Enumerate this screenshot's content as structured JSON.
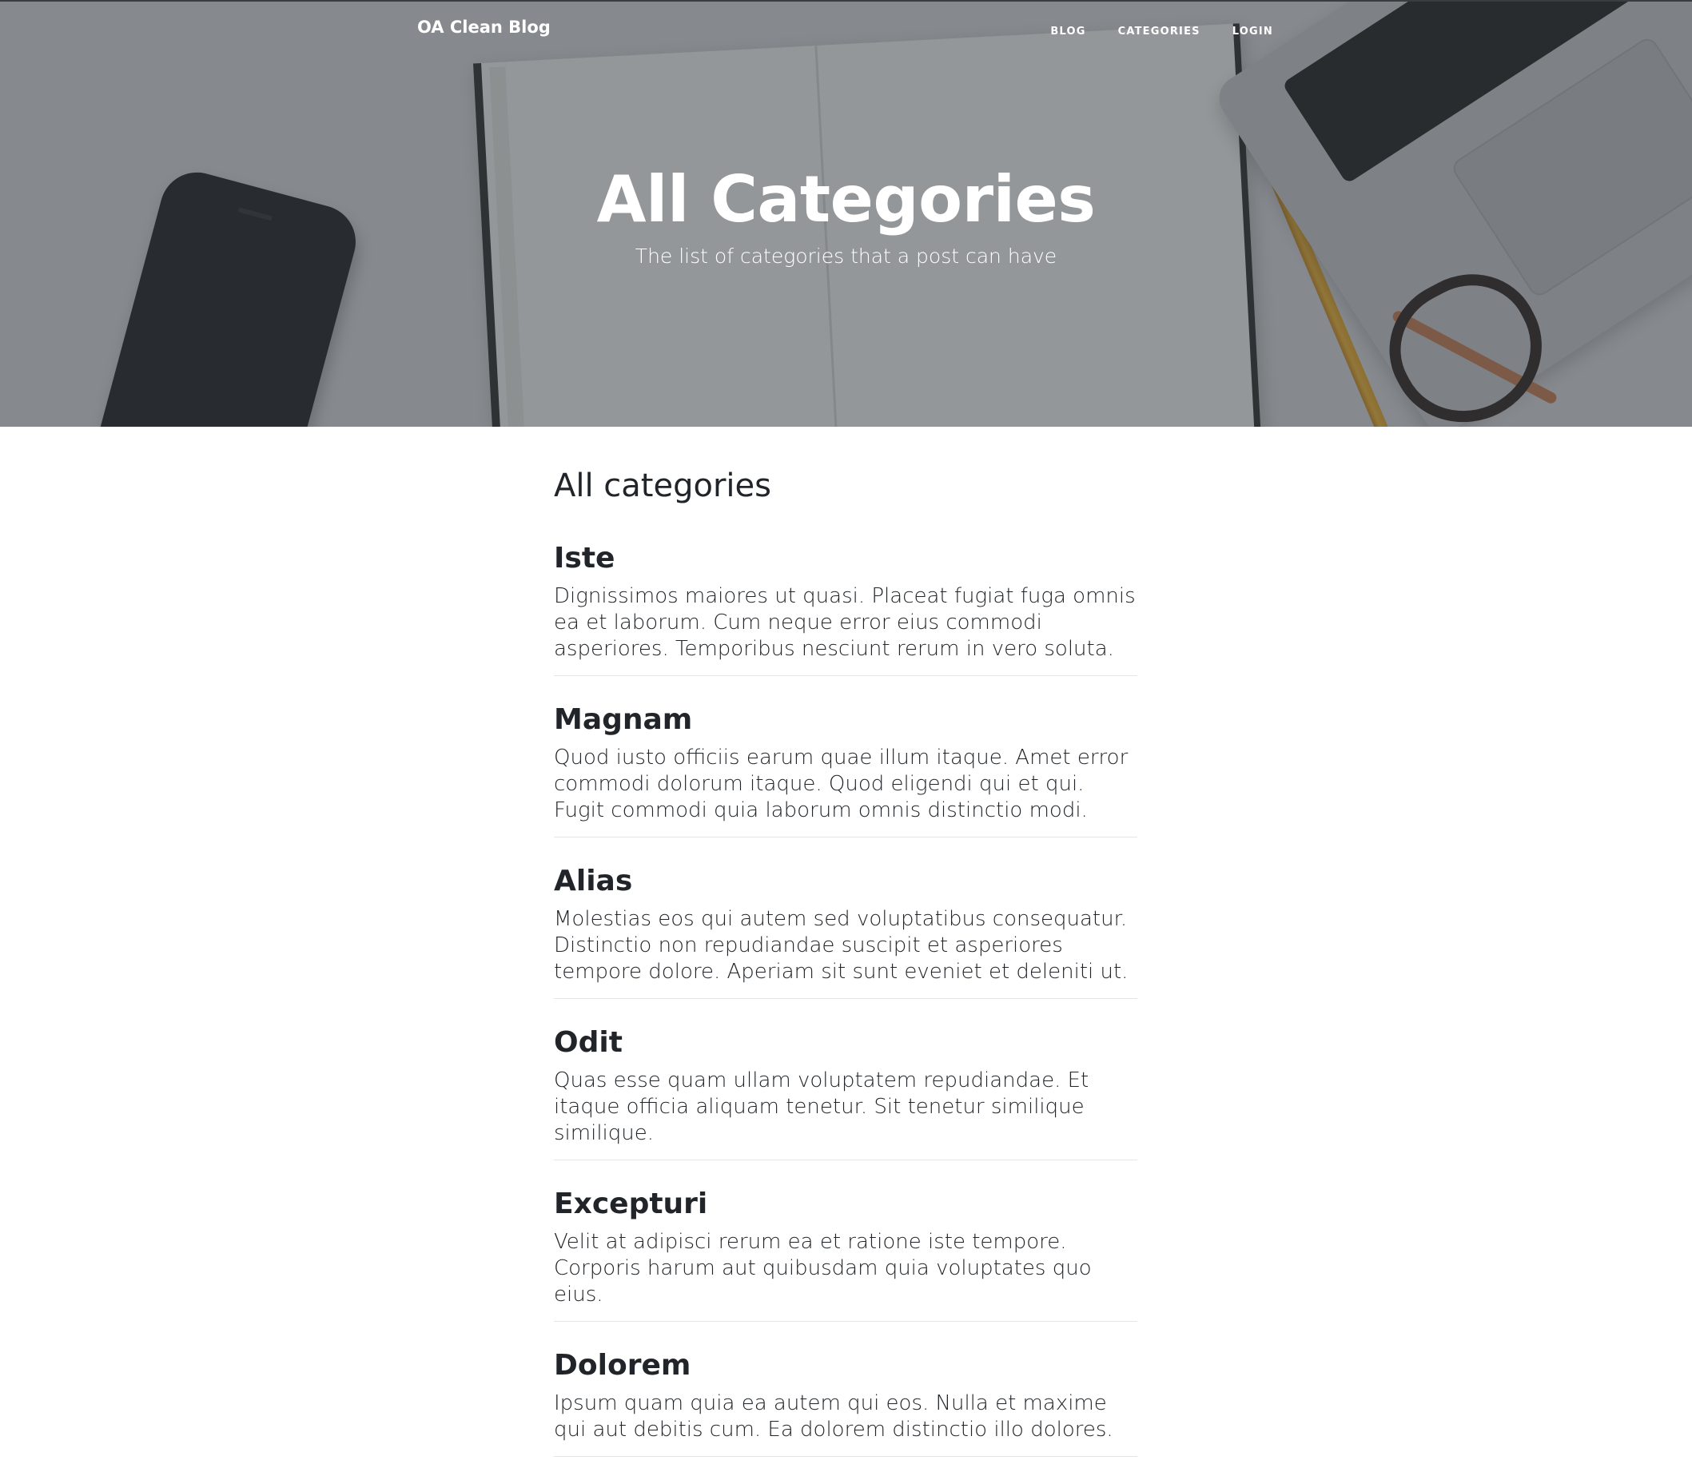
{
  "navbar": {
    "brand": "OA Clean Blog",
    "links": [
      {
        "label": "BLOG"
      },
      {
        "label": "CATEGORIES"
      },
      {
        "label": "LOGIN"
      }
    ]
  },
  "hero": {
    "title": "All Categories",
    "subtitle": "The list of categories that a post can have"
  },
  "main": {
    "section_title": "All categories",
    "categories": [
      {
        "name": "Iste",
        "description": "Dignissimos maiores ut quasi. Placeat fugiat fuga omnis ea et laborum. Cum neque error eius commodi asperiores. Temporibus nesciunt rerum in vero soluta."
      },
      {
        "name": "Magnam",
        "description": "Quod iusto officiis earum quae illum itaque. Amet error commodi dolorum itaque. Quod eligendi qui et qui. Fugit commodi quia laborum omnis distinctio modi."
      },
      {
        "name": "Alias",
        "description": "Molestias eos qui autem sed voluptatibus consequatur. Distinctio non repudiandae suscipit et asperiores tempore dolore. Aperiam sit sunt eveniet et deleniti ut."
      },
      {
        "name": "Odit",
        "description": "Quas esse quam ullam voluptatem repudiandae. Et itaque officia aliquam tenetur. Sit tenetur similique similique."
      },
      {
        "name": "Excepturi",
        "description": "Velit at adipisci rerum ea et ratione iste tempore. Corporis harum aut quibusdam quia voluptates quo eius."
      },
      {
        "name": "Dolorem",
        "description": "Ipsum quam quia ea autem qui eos. Nulla et maxime qui aut debitis cum. Ea dolorem distinctio illo dolores."
      }
    ]
  },
  "colors": {
    "text": "#212529",
    "overlay": "#343a40",
    "divider": "#e3e5e7",
    "header_text": "#ffffff"
  }
}
